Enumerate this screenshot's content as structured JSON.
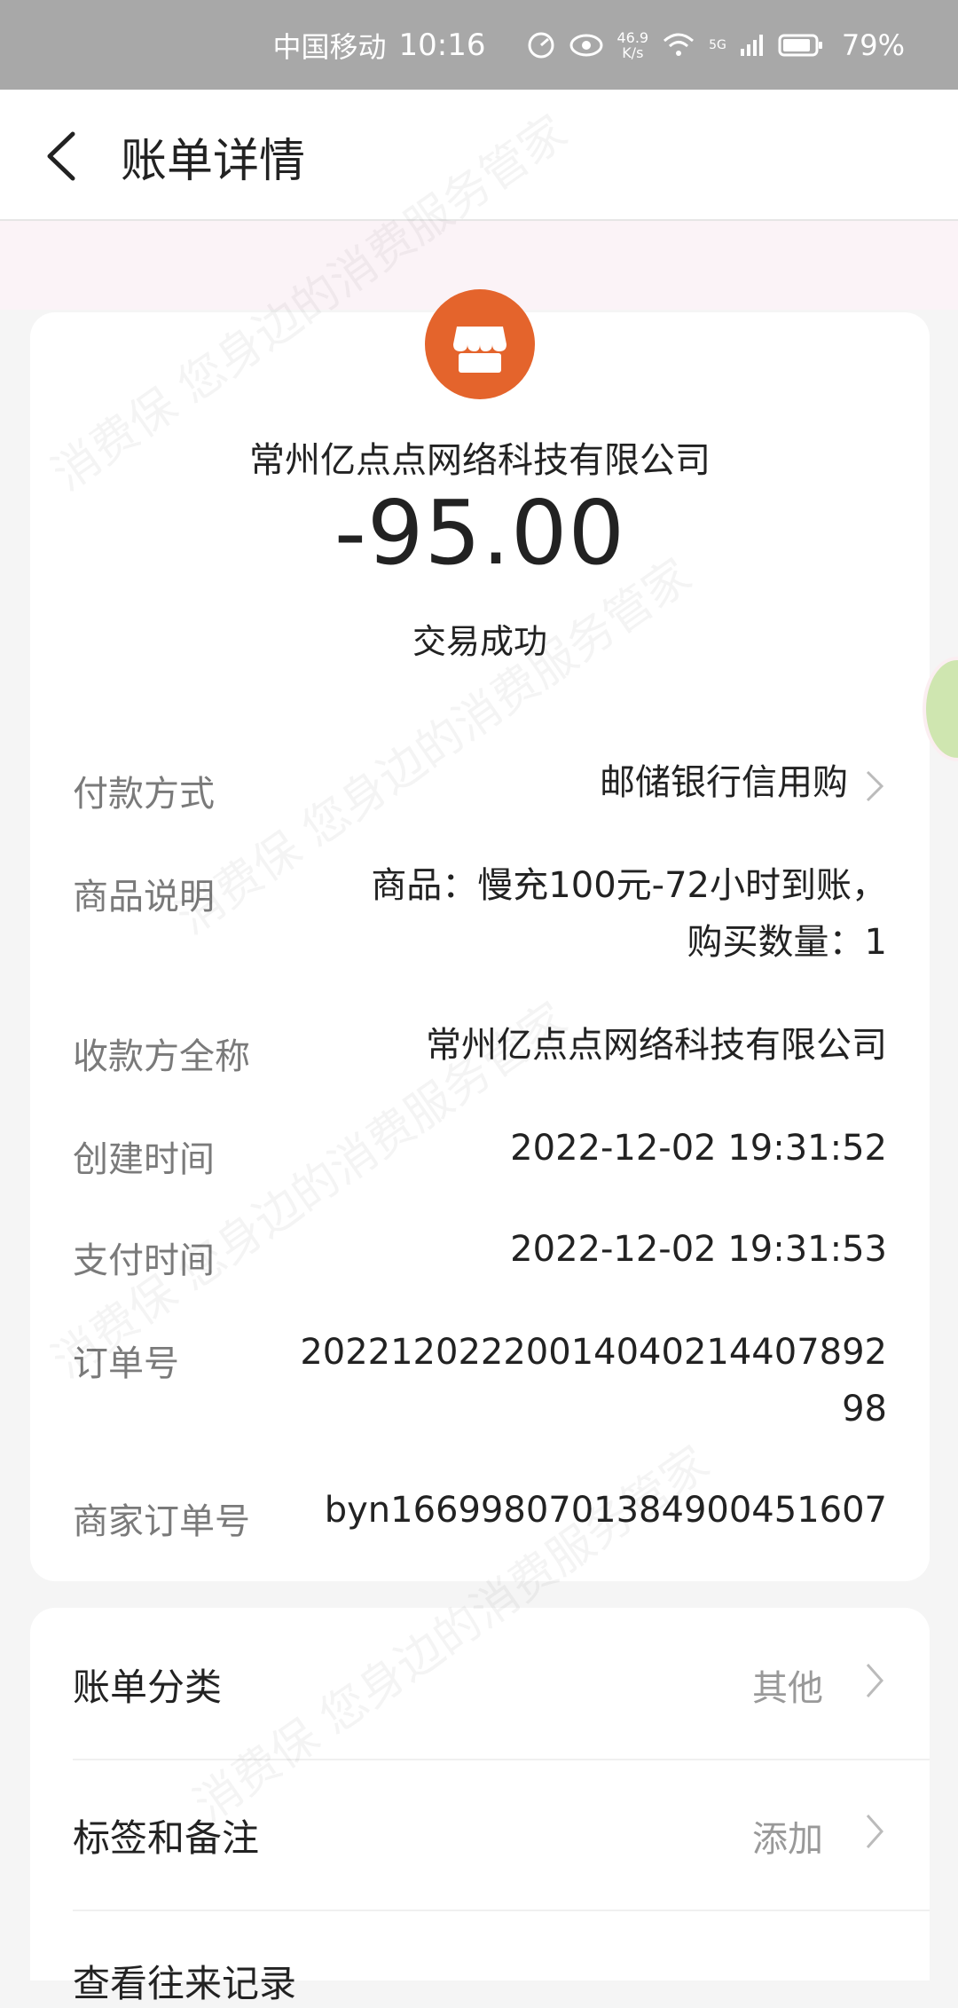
{
  "status_bar": {
    "carrier": "中国移动",
    "time": "10:16",
    "net_speed_value": "46.9",
    "net_speed_unit": "K/s",
    "signal_label": "5G",
    "battery": "79%"
  },
  "header": {
    "title": "账单详情"
  },
  "bill": {
    "merchant_name": "常州亿点点网络科技有限公司",
    "amount": "-95.00",
    "status": "交易成功"
  },
  "details": {
    "payment_method_label": "付款方式",
    "payment_method_value": "邮储银行信用购",
    "product_label": "商品说明",
    "product_value_line1": "商品：慢充100元-72小时到账，",
    "product_value_line2": "购买数量：1",
    "payee_label": "收款方全称",
    "payee_value": "常州亿点点网络科技有限公司",
    "created_label": "创建时间",
    "created_value": "2022-12-02 19:31:52",
    "paid_label": "支付时间",
    "paid_value": "2022-12-02 19:31:53",
    "order_label": "订单号",
    "order_value_line1": "20221202220014040214407892",
    "order_value_line2": "98",
    "merchant_order_label": "商家订单号",
    "merchant_order_value": "byn16699807013849004516​07"
  },
  "categories": {
    "bill_category_label": "账单分类",
    "bill_category_value": "其他",
    "tags_label": "标签和备注",
    "tags_value": "添加",
    "history_label": "查看往来记录"
  },
  "watermark": {
    "text_a": "消费保 您身边的消费服务管家"
  },
  "colors": {
    "merchant_icon": "#e4642c",
    "status_bar": "#a8a8a8"
  }
}
